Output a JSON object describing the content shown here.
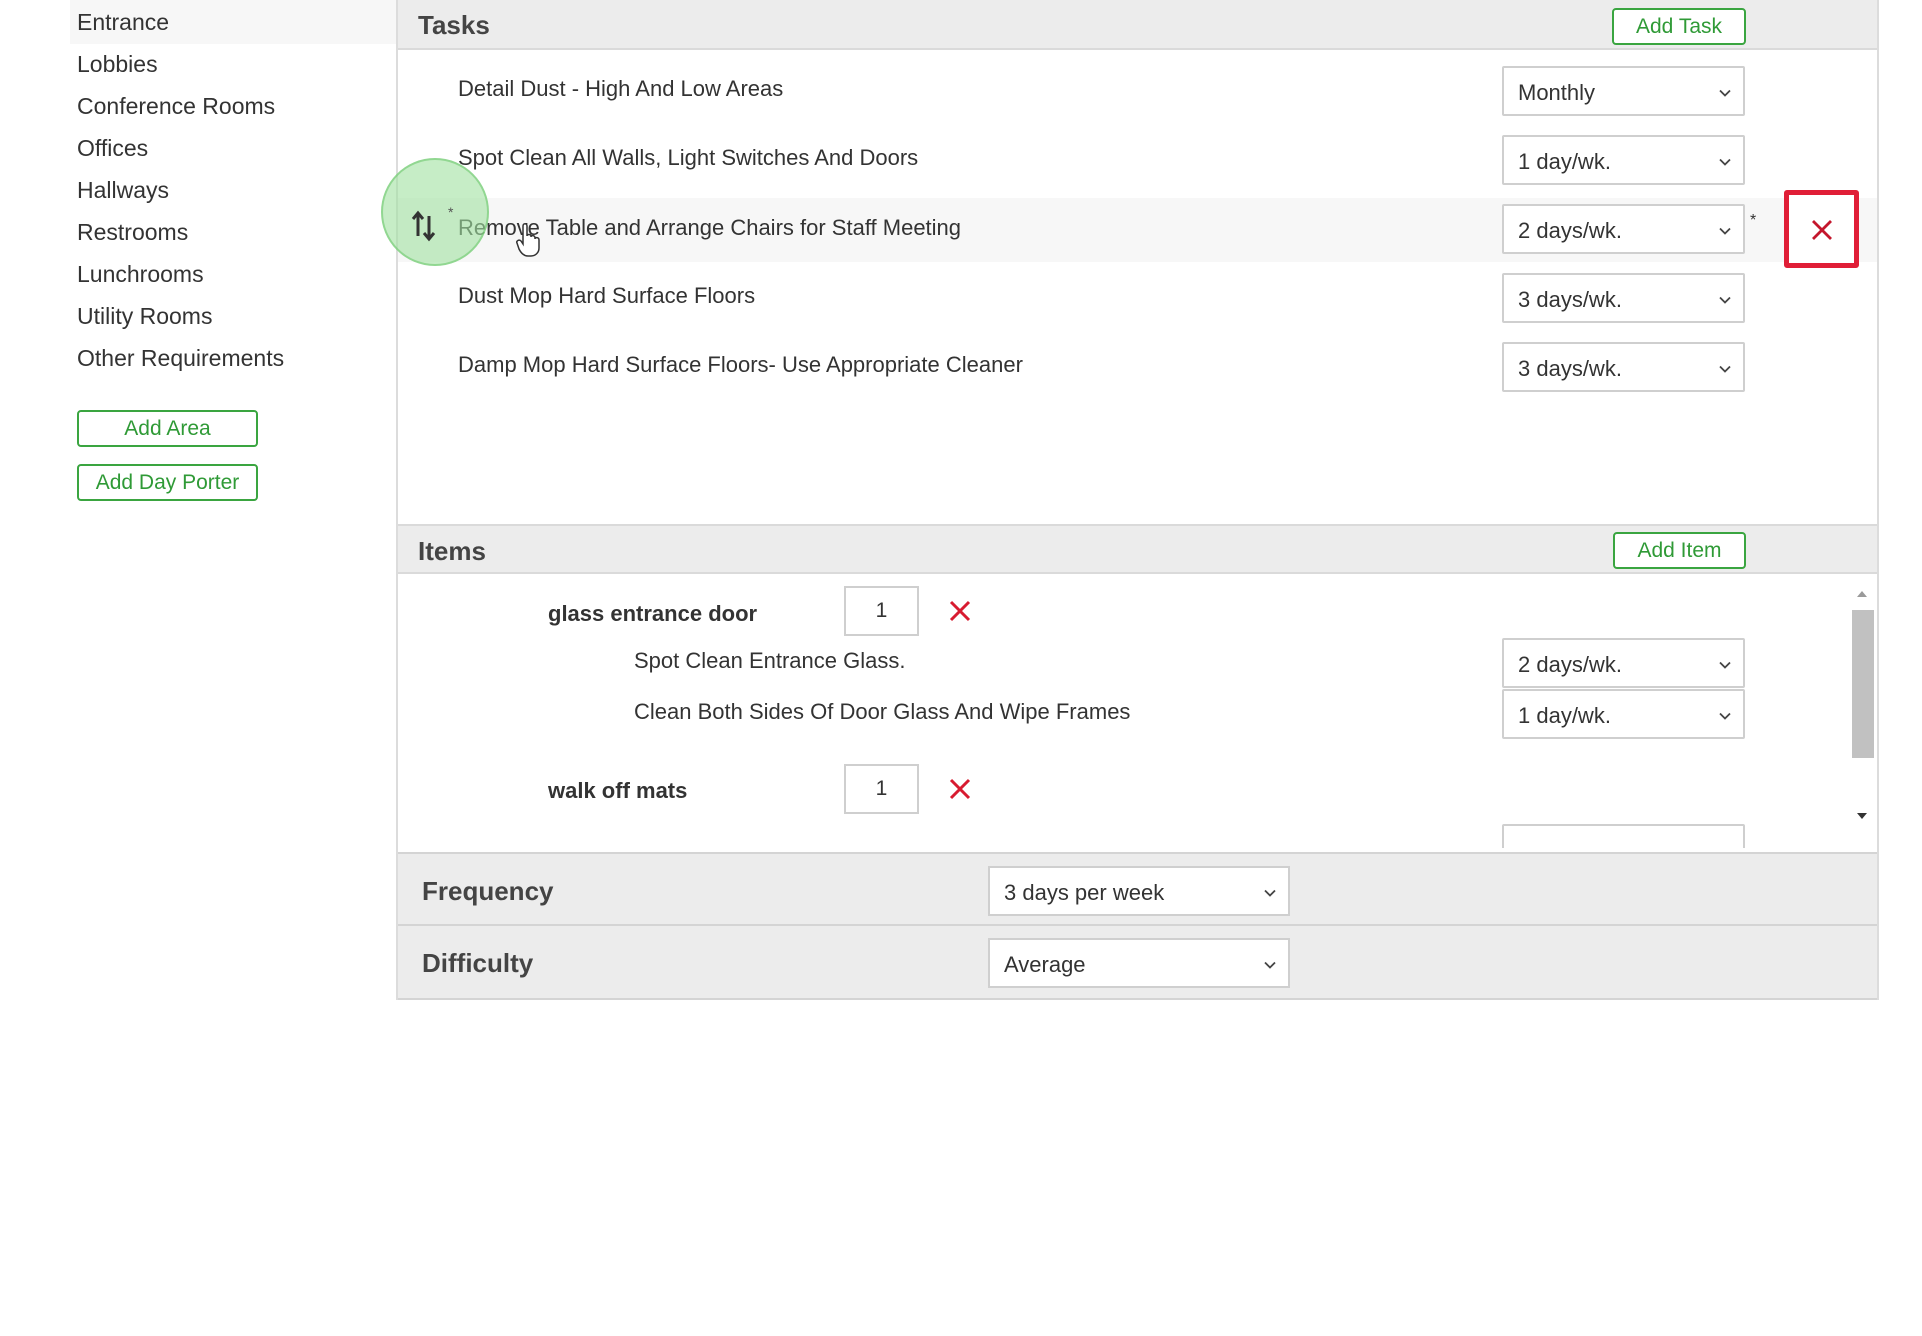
{
  "sidebar": {
    "items": [
      {
        "label": "Entrance"
      },
      {
        "label": "Lobbies"
      },
      {
        "label": "Conference Rooms"
      },
      {
        "label": "Offices"
      },
      {
        "label": "Hallways"
      },
      {
        "label": "Restrooms"
      },
      {
        "label": "Lunchrooms"
      },
      {
        "label": "Utility Rooms"
      },
      {
        "label": "Other Requirements"
      }
    ],
    "add_area_label": "Add Area",
    "add_day_porter_label": "Add Day Porter"
  },
  "tasks": {
    "title": "Tasks",
    "add_label": "Add Task",
    "rows": [
      {
        "label": "Detail Dust - High And Low Areas",
        "frequency": "Monthly"
      },
      {
        "label": "Spot Clean All Walls, Light Switches And Doors",
        "frequency": "1 day/wk."
      },
      {
        "label": "Remove Table and Arrange Chairs for Staff Meeting",
        "frequency": "2 days/wk.",
        "marker": "*"
      },
      {
        "label": "Dust Mop Hard Surface Floors",
        "frequency": "3 days/wk."
      },
      {
        "label": "Damp Mop Hard Surface Floors- Use Appropriate Cleaner",
        "frequency": "3 days/wk."
      }
    ]
  },
  "items": {
    "title": "Items",
    "add_label": "Add Item",
    "list": [
      {
        "name": "glass entrance door",
        "quantity": "1",
        "tasks": [
          {
            "label": "Spot Clean Entrance Glass.",
            "frequency": "2 days/wk."
          },
          {
            "label": "Clean Both Sides Of Door Glass And Wipe Frames",
            "frequency": "1 day/wk."
          }
        ]
      },
      {
        "name": "walk off mats",
        "quantity": "1",
        "tasks": []
      }
    ]
  },
  "frequency": {
    "label": "Frequency",
    "value": "3 days per week"
  },
  "difficulty": {
    "label": "Difficulty",
    "value": "Average"
  },
  "colors": {
    "accent_green": "#3aa540",
    "delete_red": "#e01e37"
  }
}
